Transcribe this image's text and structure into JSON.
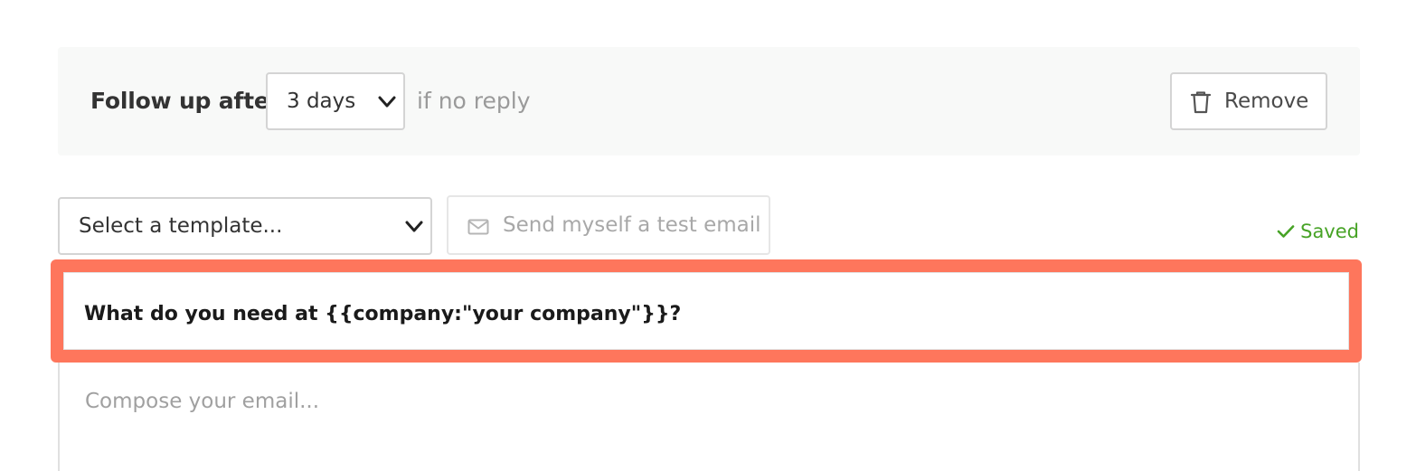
{
  "followup": {
    "label": "Follow up after",
    "delay_value": "3 days",
    "suffix": "if no reply",
    "remove_label": "Remove",
    "remove_icon": "trash-icon"
  },
  "toolbar": {
    "template_placeholder": "Select a template...",
    "test_email_label": "Send myself a test email",
    "test_email_icon": "envelope-icon",
    "saved_label": "Saved",
    "saved_color": "#47a326"
  },
  "editor": {
    "subject": "What do you need at {{company:\"your company\"}}?",
    "body_placeholder": "Compose your email...",
    "highlight_color": "#fe765c"
  }
}
